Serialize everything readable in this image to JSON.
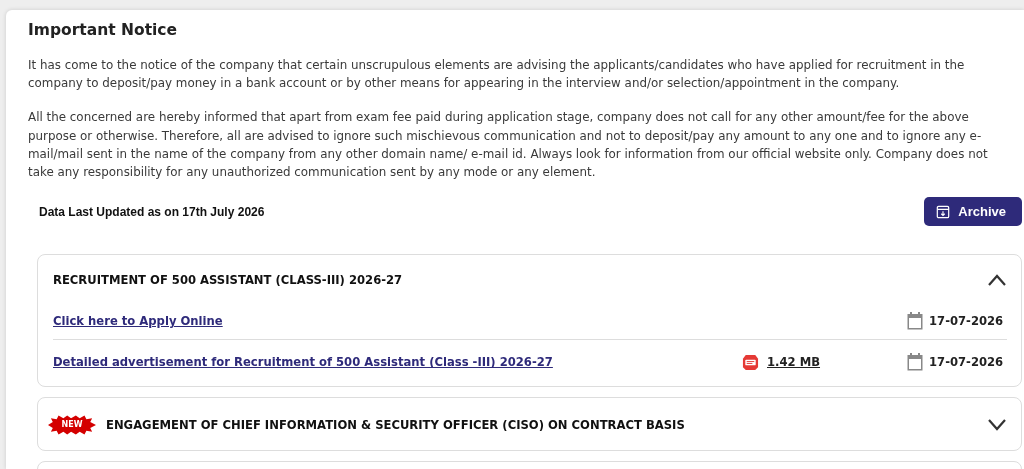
{
  "notice": {
    "title": "Important Notice",
    "paragraphs": [
      "It has come to the notice of the company that certain unscrupulous elements are advising the applicants/candidates who have applied for recruitment in the company to deposit/pay money in a bank account or by other means for appearing in the interview and/or selection/appointment in the company.",
      "All the concerned are hereby informed that apart from exam fee paid during application stage, company does not call for any other amount/fee for the above purpose or otherwise. Therefore, all are advised to ignore such mischievous communication and not to deposit/pay any amount to any one and to ignore any e-mail/mail sent in the name of the company from any other domain name/ e-mail id. Always look for information from our official website only. Company does not take any responsibility for any unauthorized communication sent by any mode or any element."
    ]
  },
  "updated": "Data Last Updated as on 17th July 2026",
  "archive_button": "Archive",
  "accordion": [
    {
      "kind": "section",
      "title": "RECRUITMENT OF 500 ASSISTANT (CLASS-III) 2026-27",
      "new": false,
      "expanded": true,
      "links": [
        {
          "label": "Click here to Apply Online",
          "date": "17-07-2026"
        },
        {
          "label": "Detailed advertisement for Recruitment of 500 Assistant (Class -III) 2026-27",
          "size": "1.42 MB",
          "date": "17-07-2026"
        }
      ]
    },
    {
      "kind": "section",
      "title": "ENGAGEMENT OF CHIEF INFORMATION & SECURITY OFFICER (CISO) ON CONTRACT BASIS",
      "new": true,
      "new_label": "NEW",
      "expanded": false
    },
    {
      "kind": "blank"
    }
  ]
}
